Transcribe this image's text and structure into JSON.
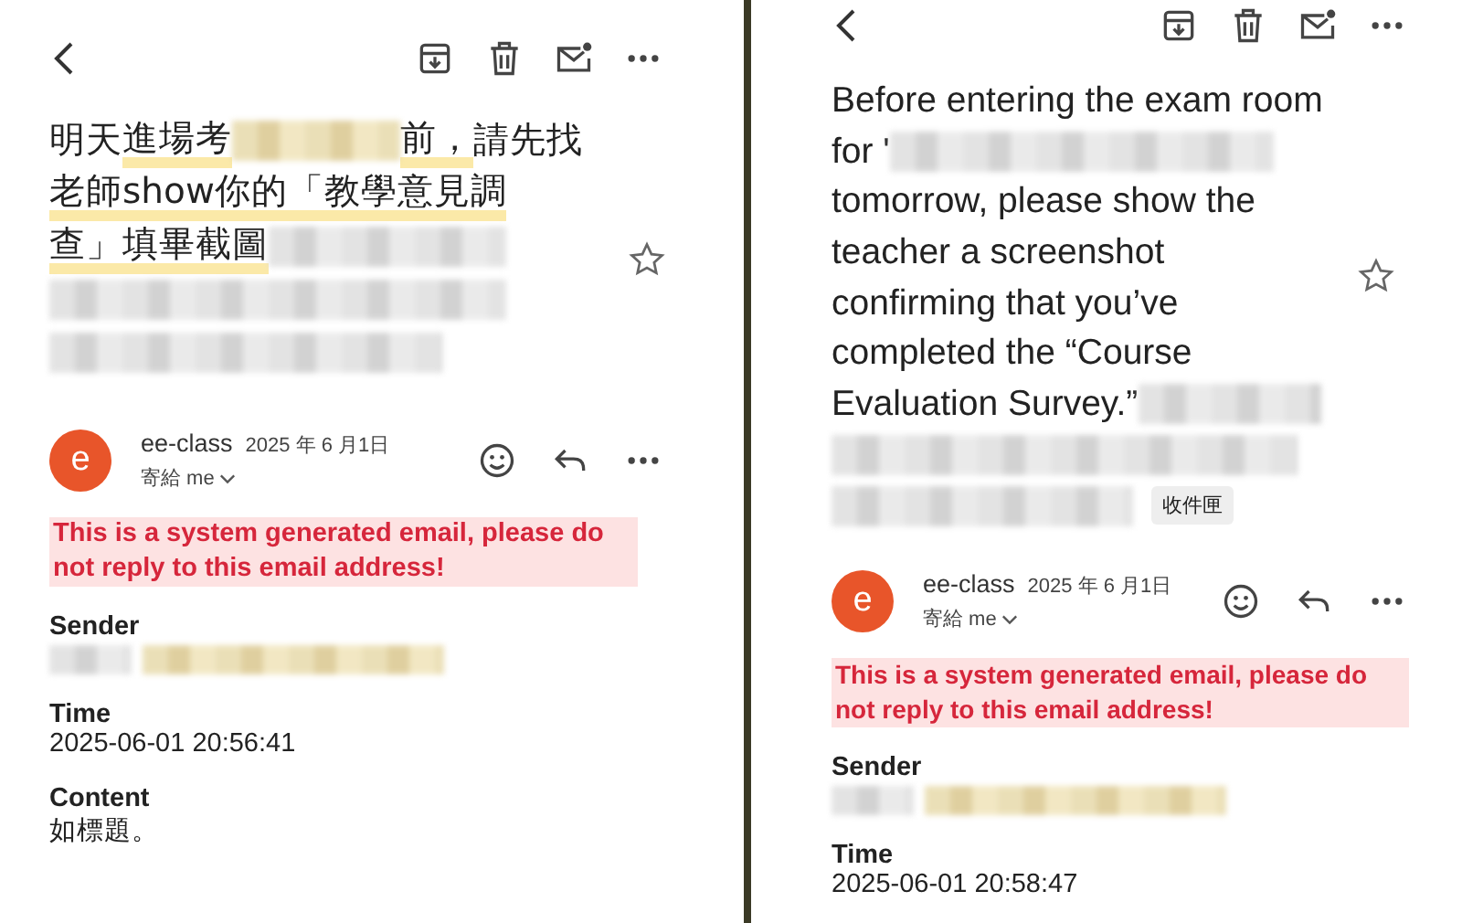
{
  "panels": [
    {
      "subject_lines": [
        [
          {
            "kind": "text",
            "text": "明天",
            "highlighted": false
          },
          {
            "kind": "text",
            "text": "進場考",
            "highlighted": true
          },
          {
            "kind": "redacted",
            "highlighted": true
          },
          {
            "kind": "text",
            "text": "前，",
            "highlighted": true
          },
          {
            "kind": "text",
            "text": "請先找",
            "highlighted": false
          }
        ],
        [
          {
            "kind": "text",
            "text": "老師show你的「教學意見調",
            "highlighted": true
          }
        ],
        [
          {
            "kind": "text",
            "text": "查」填畢截圖",
            "highlighted": true
          },
          {
            "kind": "redacted",
            "highlighted": false
          }
        ],
        [
          {
            "kind": "redacted",
            "highlighted": false
          }
        ],
        [
          {
            "kind": "redacted",
            "highlighted": false
          }
        ]
      ],
      "message": {
        "avatar": "e",
        "sender": "ee-class",
        "date": "2025 年 6 月1日",
        "recipient": "寄給 me",
        "warning": "This is a system generated email, please do not reply to this email address!",
        "fields": [
          {
            "label": "Sender",
            "kind": "redacted"
          },
          {
            "label": "Time",
            "kind": "text",
            "value": "2025-06-01 20:56:41"
          },
          {
            "label": "Content",
            "kind": "text",
            "value": "如標題。"
          }
        ]
      }
    },
    {
      "subject_lines": [
        [
          {
            "kind": "text",
            "text": "Before entering the exam room",
            "highlighted": false
          }
        ],
        [
          {
            "kind": "text",
            "text": "for '",
            "highlighted": false
          },
          {
            "kind": "redacted",
            "highlighted": false
          }
        ],
        [
          {
            "kind": "text",
            "text": "tomorrow, please show the",
            "highlighted": false
          }
        ],
        [
          {
            "kind": "text",
            "text": "teacher a screenshot",
            "highlighted": false
          }
        ],
        [
          {
            "kind": "text",
            "text": "confirming that you’ve",
            "highlighted": false
          }
        ],
        [
          {
            "kind": "text",
            "text": "completed the “Course",
            "highlighted": false
          }
        ],
        [
          {
            "kind": "text",
            "text": "Evaluation Survey.”",
            "highlighted": false
          },
          {
            "kind": "redacted",
            "highlighted": false
          }
        ],
        [
          {
            "kind": "redacted",
            "highlighted": false
          }
        ],
        [
          {
            "kind": "redacted",
            "highlighted": false
          }
        ]
      ],
      "label": "收件匣",
      "message": {
        "avatar": "e",
        "sender": "ee-class",
        "date": "2025 年 6 月1日",
        "recipient": "寄給 me",
        "warning": "This is a system generated email, please do not reply to this email address!",
        "fields": [
          {
            "label": "Sender",
            "kind": "redacted"
          },
          {
            "label": "Time",
            "kind": "text",
            "value": "2025-06-01 20:58:47"
          }
        ]
      }
    }
  ]
}
